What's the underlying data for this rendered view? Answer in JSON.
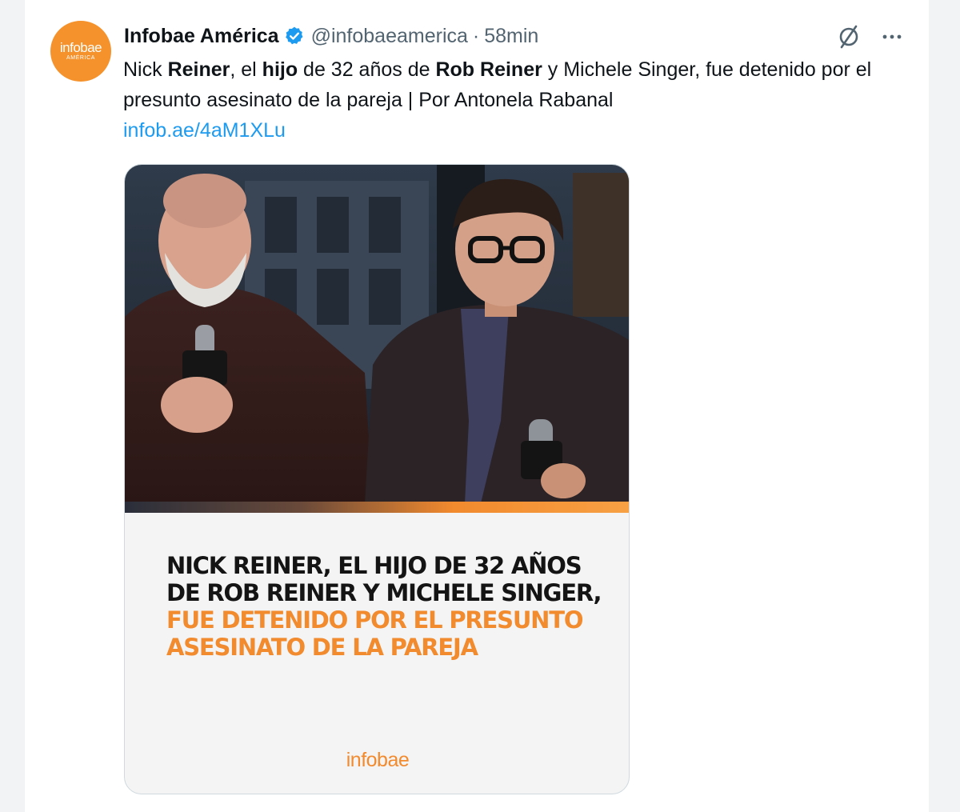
{
  "tweet": {
    "avatar": {
      "line1": "infobae",
      "line2": "AMÉRICA",
      "color": "#f5922b"
    },
    "author_name": "Infobae América",
    "handle": "@infobaeamerica",
    "separator": "·",
    "time": "58min",
    "verified_icon": "verified-badge-icon",
    "actions": [
      "grok-icon",
      "more-icon"
    ],
    "text": {
      "p1": "Nick ",
      "b1": "Reiner",
      "p2": ", el ",
      "b2": "hijo",
      "p3": " de 32 años de ",
      "b3": "Rob Reiner",
      "p4": " y Michele Singer, fue detenido por el presunto asesinato de la pareja | Por Antonela Rabanal",
      "link": "infob.ae/4aM1XLu"
    },
    "card": {
      "headline_black": "NICK REINER, EL HIJO DE 32 AÑOS DE ROB REINER Y MICHELE SINGER, ",
      "headline_orange": "FUE DETENIDO POR EL PRESUNTO ASESINATO DE LA PAREJA",
      "logo_text": "infobae",
      "accent_color": "#f28a2e"
    }
  }
}
